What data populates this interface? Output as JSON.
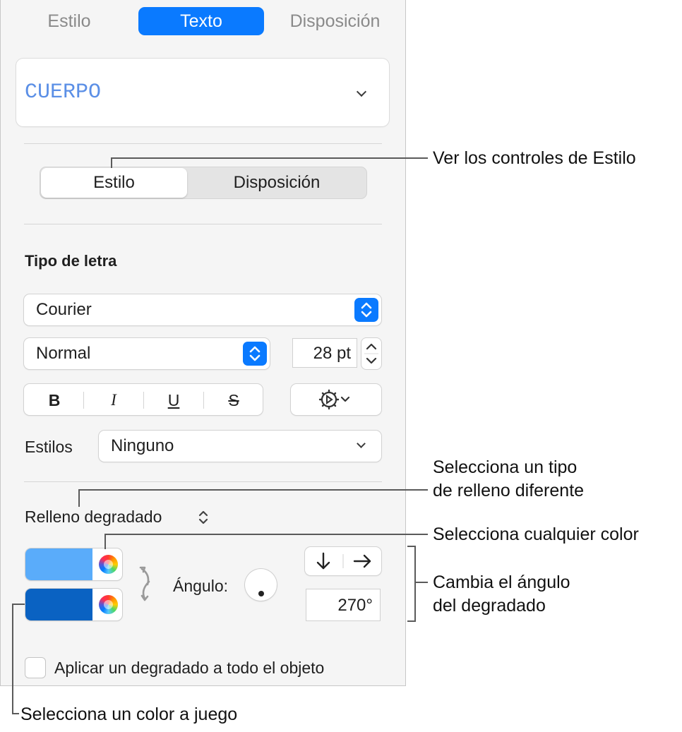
{
  "tabs": [
    "Estilo",
    "Texto",
    "Disposición"
  ],
  "paragraph_style": {
    "name": "CUERPO",
    "color": "#5b8fe6"
  },
  "segment": {
    "selected": "Estilo",
    "other": "Disposición"
  },
  "font": {
    "section_title": "Tipo de letra",
    "family": "Courier",
    "typeface": "Normal",
    "size": "28 pt",
    "format_buttons": [
      "B",
      "I",
      "U",
      "S"
    ],
    "styles_label": "Estilos",
    "styles_value": "Ninguno"
  },
  "fill": {
    "type_label": "Relleno degradado",
    "color_top": "#5aacfa",
    "color_bottom": "#0a62c2",
    "angle_label": "Ángulo:",
    "angle_value": "270°",
    "apply_all_label": "Aplicar un degradado a todo el objeto",
    "apply_all_checked": false
  },
  "callouts": {
    "style_controls": "Ver los controles de Estilo",
    "fill_type_line1": "Selecciona un tipo",
    "fill_type_line2": "de relleno diferente",
    "any_color": "Selecciona cualquier color",
    "angle_line1": "Cambia el ángulo",
    "angle_line2": "del degradado",
    "matching_color": "Selecciona un color a juego"
  },
  "accent_color": "#0a7aff"
}
